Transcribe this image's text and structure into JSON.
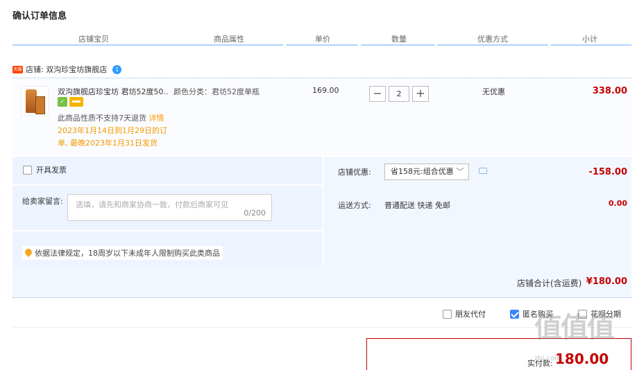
{
  "page_title": "确认订单信息",
  "columns": [
    "店铺宝贝",
    "商品属性",
    "单价",
    "数量",
    "优惠方式",
    "小计"
  ],
  "shop": {
    "badge": "天猫",
    "label": "店铺: 双沟珍宝坊旗舰店"
  },
  "item": {
    "name": "双沟旗舰店珍宝坊 君坊52度50...",
    "attribute": "颜色分类：君坊52度单瓶",
    "price": "169.00",
    "quantity": "2",
    "promo": "无优惠",
    "subtotal": "338.00",
    "return_note": "此商品性质不支持7天退货",
    "return_detail": "详情",
    "ship_note": "2023年1月14日到1月29日的订单, 最晚2023年1月31日发货"
  },
  "invoice_label": "开具发票",
  "message": {
    "label": "给卖家留言:",
    "placeholder": "选填，请先和商家协商一致，付款后商家可见",
    "count": "0/200"
  },
  "law_note": "依据法律规定，18周岁以下未成年人限制购买此类商品",
  "shop_coupon": {
    "label": "店铺优惠:",
    "value": "省158元:组合优惠",
    "amount": "-158.00"
  },
  "shipping": {
    "label": "运送方式:",
    "value": "普通配送 快递 免邮",
    "amount": "0.00"
  },
  "shop_total": {
    "label": "店铺合计(含运费)",
    "amount": "¥180.00"
  },
  "options": {
    "friend_pay": {
      "label": "朋友代付",
      "checked": false
    },
    "anonymous": {
      "label": "匿名购买",
      "checked": true
    },
    "huabei": {
      "label": "花呗分期",
      "checked": false
    }
  },
  "payment": {
    "label": "实付款:",
    "amount": "180.00"
  },
  "watermark": {
    "mark": "值值值",
    "domain": "zhi.com"
  },
  "colors": {
    "price_red": "#c40000",
    "accent_blue": "#3a86ff",
    "note_orange": "#f39a00"
  }
}
